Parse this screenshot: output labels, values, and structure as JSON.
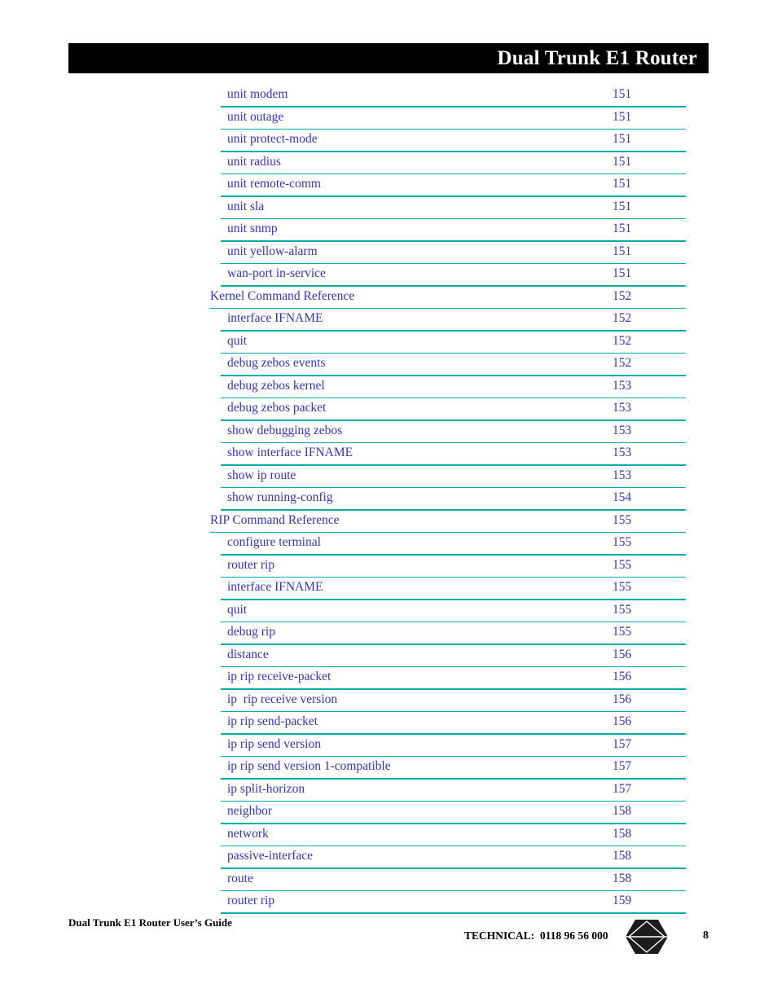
{
  "header": {
    "title": "Dual Trunk E1 Router"
  },
  "toc": {
    "entries": [
      {
        "label": "unit modem",
        "page": "151",
        "level": 2
      },
      {
        "label": "unit outage",
        "page": "151",
        "level": 2
      },
      {
        "label": "unit protect-mode",
        "page": "151",
        "level": 2
      },
      {
        "label": "unit radius",
        "page": "151",
        "level": 2
      },
      {
        "label": "unit remote-comm",
        "page": "151",
        "level": 2
      },
      {
        "label": "unit sla",
        "page": "151",
        "level": 2
      },
      {
        "label": "unit snmp",
        "page": "151",
        "level": 2
      },
      {
        "label": "unit yellow-alarm",
        "page": "151",
        "level": 2
      },
      {
        "label": "wan-port in-service",
        "page": "151",
        "level": 2
      },
      {
        "label": "Kernel Command Reference",
        "page": "152",
        "level": 1
      },
      {
        "label": "interface IFNAME",
        "page": "152",
        "level": 2
      },
      {
        "label": "quit",
        "page": "152",
        "level": 2
      },
      {
        "label": "debug zebos events",
        "page": "152",
        "level": 2
      },
      {
        "label": "debug zebos kernel",
        "page": "153",
        "level": 2
      },
      {
        "label": "debug zebos packet",
        "page": "153",
        "level": 2
      },
      {
        "label": "show debugging zebos",
        "page": "153",
        "level": 2
      },
      {
        "label": "show interface IFNAME",
        "page": "153",
        "level": 2
      },
      {
        "label": "show ip route",
        "page": "153",
        "level": 2
      },
      {
        "label": "show running-config",
        "page": "154",
        "level": 2
      },
      {
        "label": "RIP Command Reference",
        "page": "155",
        "level": 1
      },
      {
        "label": "configure terminal",
        "page": "155",
        "level": 2
      },
      {
        "label": "router rip",
        "page": "155",
        "level": 2
      },
      {
        "label": "interface IFNAME",
        "page": "155",
        "level": 2
      },
      {
        "label": "quit",
        "page": "155",
        "level": 2
      },
      {
        "label": "debug rip",
        "page": "155",
        "level": 2
      },
      {
        "label": "distance",
        "page": "156",
        "level": 2
      },
      {
        "label": "ip rip receive-packet",
        "page": "156",
        "level": 2
      },
      {
        "label": "ip  rip receive version",
        "page": "156",
        "level": 2
      },
      {
        "label": "ip rip send-packet",
        "page": "156",
        "level": 2
      },
      {
        "label": "ip rip send version",
        "page": "157",
        "level": 2
      },
      {
        "label": "ip rip send version 1-compatible",
        "page": "157",
        "level": 2
      },
      {
        "label": "ip split-horizon",
        "page": "157",
        "level": 2
      },
      {
        "label": "neighbor",
        "page": "158",
        "level": 2
      },
      {
        "label": "network",
        "page": "158",
        "level": 2
      },
      {
        "label": "passive-interface",
        "page": "158",
        "level": 2
      },
      {
        "label": "route",
        "page": "158",
        "level": 2
      },
      {
        "label": "router rip",
        "page": "159",
        "level": 2
      }
    ]
  },
  "footer": {
    "guide_title": "Dual Trunk E1 Router User’s Guide",
    "technical": "TECHNICAL:  0118 96 56 000",
    "logo_icon": "hexagon-diamond-logo-icon",
    "page_number": "8"
  },
  "colors": {
    "header_bar": "#000000",
    "header_text": "#ffffff",
    "link_text": "#3333c8",
    "rule": "#00adad",
    "footer_text": "#000000",
    "page_background": "#ffffff"
  }
}
